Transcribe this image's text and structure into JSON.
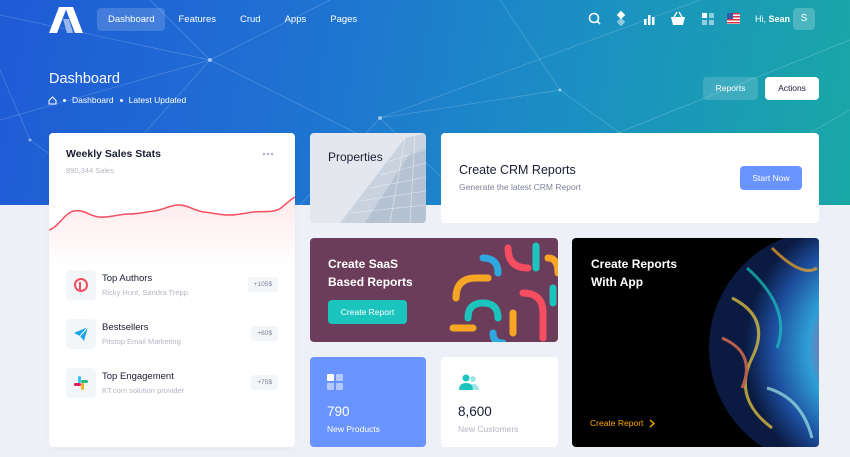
{
  "nav": {
    "items": [
      "Dashboard",
      "Features",
      "Crud",
      "Apps",
      "Pages"
    ],
    "active": "Dashboard"
  },
  "topbar": {
    "icons": [
      "search-icon",
      "layers-icon",
      "bar-chart-icon",
      "basket-icon",
      "apps-grid-icon",
      "us-flag-icon"
    ],
    "greeting_prefix": "Hi,",
    "user_name": "Sean",
    "avatar_initial": "S"
  },
  "header": {
    "title": "Dashboard",
    "breadcrumb": [
      "Dashboard",
      "Latest Updated"
    ],
    "reports_label": "Reports",
    "actions_label": "Actions"
  },
  "weekly_sales": {
    "title": "Weekly Sales Stats",
    "subtitle": "890,344 Sales",
    "items": [
      {
        "title": "Top Authors",
        "subtitle": "Ricky Hunt, Sandra Trepp",
        "badge": "+105$",
        "icon": "pinterest-icon"
      },
      {
        "title": "Bestsellers",
        "subtitle": "Pitstop Email Marketing",
        "badge": "+60$",
        "icon": "telegram-icon"
      },
      {
        "title": "Top Engagement",
        "subtitle": "KT.com solution provider",
        "badge": "+75$",
        "icon": "slack-icon"
      }
    ]
  },
  "properties": {
    "title": "Properties"
  },
  "crm": {
    "title": "Create CRM Reports",
    "subtitle": "Generate the latest CRM Report",
    "button": "Start Now"
  },
  "saas": {
    "title_line1": "Create SaaS",
    "title_line2": "Based Reports",
    "button": "Create Report"
  },
  "app_reports": {
    "title_line1": "Create Reports",
    "title_line2": "With App",
    "link": "Create Report"
  },
  "stats": [
    {
      "value": "790",
      "label": "New Products",
      "icon": "apps-grid-icon"
    },
    {
      "value": "8,600",
      "label": "New Customers",
      "icon": "users-icon"
    }
  ],
  "colors": {
    "primary": "#6993ff",
    "success": "#1bc5bd",
    "warning": "#ffa800",
    "danger": "#f64e60",
    "saas_bg": "#6c3d5b"
  }
}
